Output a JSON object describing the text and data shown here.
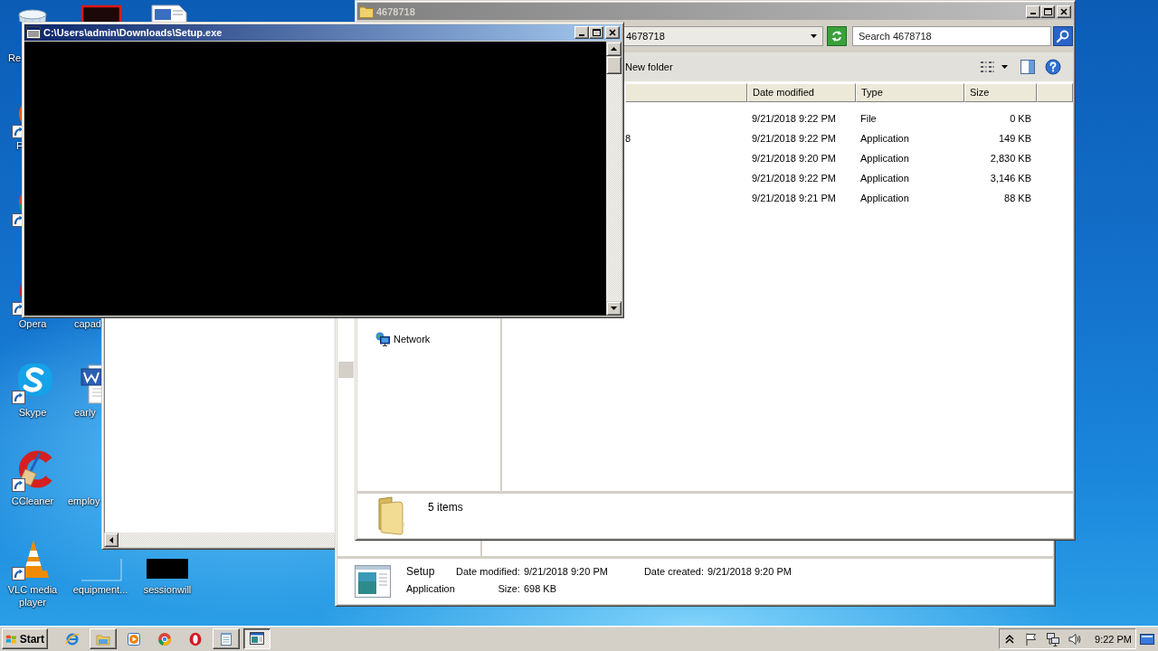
{
  "desktop": {
    "icons": [
      {
        "kind": "recycle-bin",
        "label": "Re"
      },
      {
        "kind": "firefox",
        "label": "F"
      },
      {
        "kind": "chrome"
      },
      {
        "kind": "opera",
        "label": "Opera"
      },
      {
        "kind": "skype",
        "label": "Skype"
      },
      {
        "kind": "ccleaner",
        "label": "CCleaner"
      },
      {
        "kind": "vlc",
        "label": "VLC media player"
      },
      {
        "kind": "red-app"
      },
      {
        "label": "capad"
      },
      {
        "kind": "word-document",
        "label": "early"
      },
      {
        "label": "employ"
      },
      {
        "kind": "blank",
        "label": "equipment..."
      },
      {
        "kind": "picture-document"
      },
      {
        "kind": "dark-thumbnail",
        "label": "sessionwill"
      }
    ]
  },
  "console": {
    "title": "C:\\Users\\admin\\Downloads\\Setup.exe",
    "active": true
  },
  "explorer": {
    "title": "4678718",
    "active": false,
    "address": "4678718",
    "search": {
      "placeholder": "Search 4678718"
    },
    "toolbar": [
      "New folder"
    ],
    "columns": [
      "Date modified",
      "Type",
      "Size"
    ],
    "rows": [
      {
        "date_modified": "9/21/2018 9:22 PM",
        "type": "File",
        "size": "0 KB"
      },
      {
        "name": "8",
        "date_modified": "9/21/2018 9:22 PM",
        "type": "Application",
        "size": "149 KB"
      },
      {
        "date_modified": "9/21/2018 9:20 PM",
        "type": "Application",
        "size": "2,830 KB"
      },
      {
        "date_modified": "9/21/2018 9:22 PM",
        "type": "Application",
        "size": "3,146 KB"
      },
      {
        "date_modified": "9/21/2018 9:21 PM",
        "type": "Application",
        "size": "88 KB"
      }
    ],
    "navigation": [
      {
        "kind": "network",
        "label": "Network"
      }
    ],
    "status": "5 items"
  },
  "details_window": {
    "details": {
      "name": "Setup",
      "type": "Application",
      "properties": [
        {
          "label": "Date modified:",
          "value": "9/21/2018 9:20 PM"
        },
        {
          "label": "Date created:",
          "value": "9/21/2018 9:20 PM"
        },
        {
          "label": "Size:",
          "value": "698 KB"
        }
      ]
    }
  },
  "taskbar": {
    "start": "Start",
    "items": [
      {
        "kind": "ie",
        "running": false,
        "selected": false
      },
      {
        "kind": "explorer",
        "running": true,
        "selected": false
      },
      {
        "kind": "media-player",
        "running": false,
        "selected": false
      },
      {
        "kind": "chrome",
        "running": false,
        "selected": false
      },
      {
        "kind": "opera",
        "running": false,
        "selected": false
      },
      {
        "kind": "notepad",
        "running": true,
        "selected": false
      },
      {
        "kind": "console",
        "running": true,
        "selected": true
      }
    ],
    "tray": {
      "icons": [
        {
          "kind": "chevron"
        },
        {
          "kind": "flag"
        },
        {
          "kind": "network"
        },
        {
          "kind": "speaker"
        }
      ],
      "clock": "9:22 PM"
    }
  }
}
